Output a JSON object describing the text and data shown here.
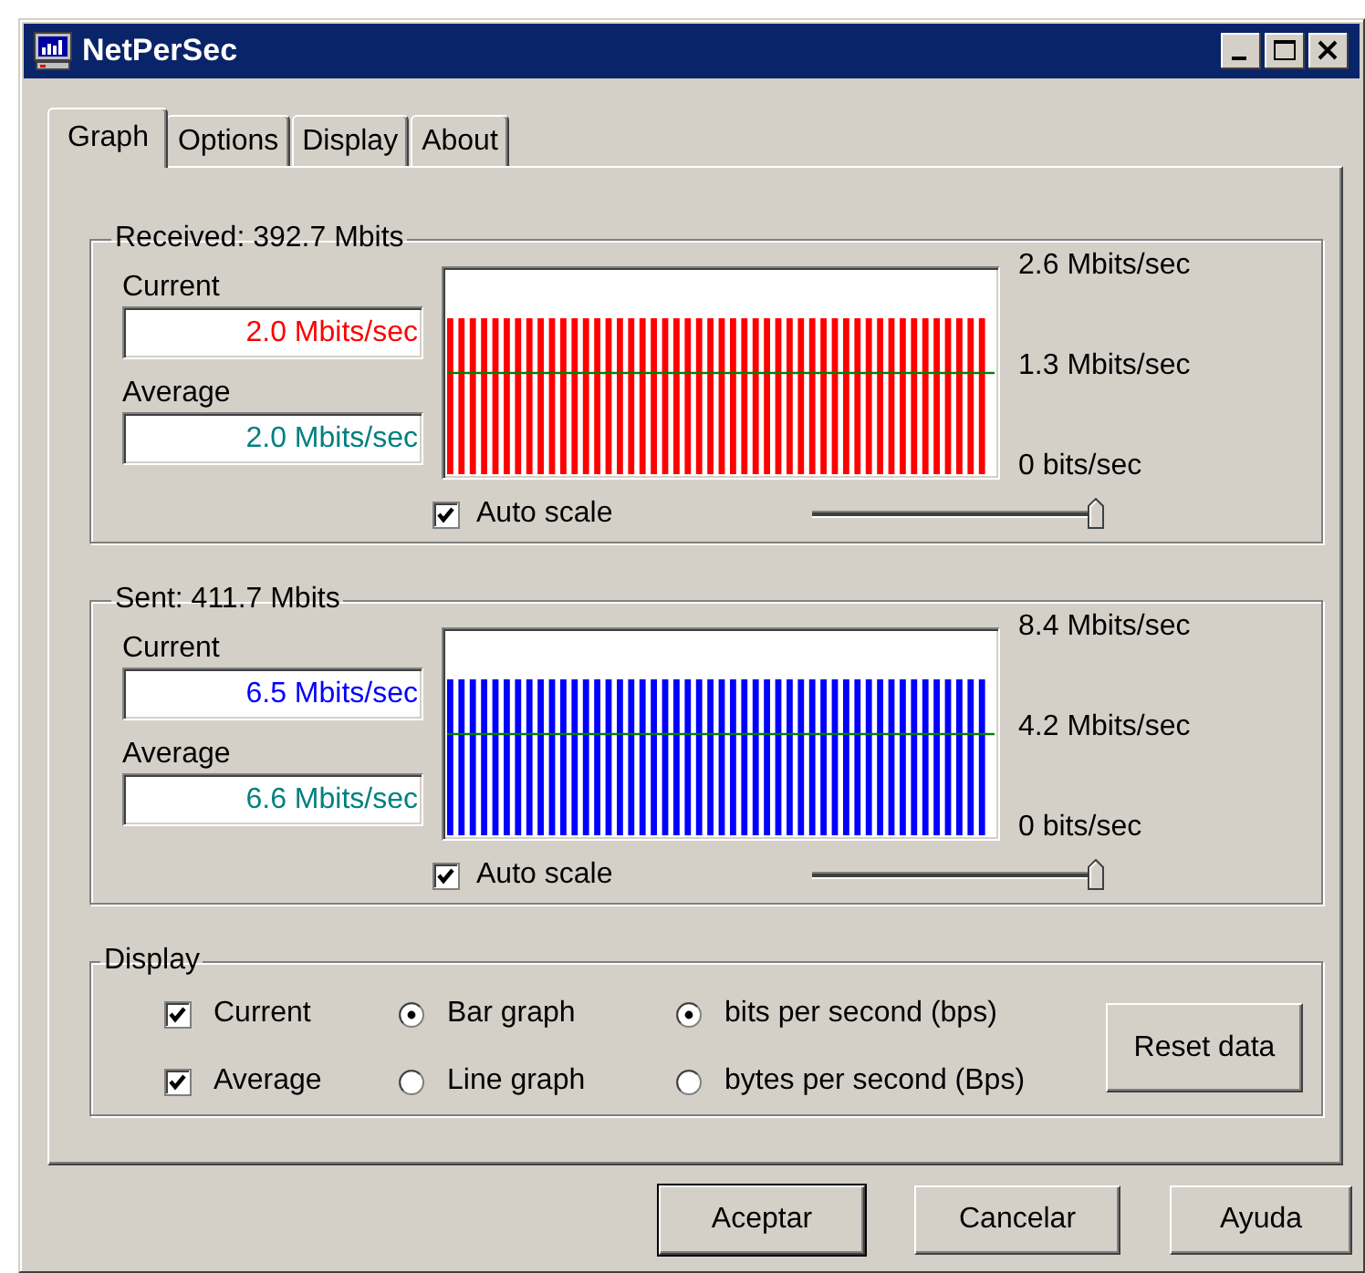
{
  "window": {
    "title": "NetPerSec"
  },
  "tabs": [
    {
      "label": "Graph",
      "selected": true
    },
    {
      "label": "Options",
      "selected": false
    },
    {
      "label": "Display",
      "selected": false
    },
    {
      "label": "About",
      "selected": false
    }
  ],
  "monitors": [
    {
      "title": "Received: 392.7 Mbits",
      "color": "#ff0000",
      "current_label": "Current",
      "current_value": "2.0 Mbits/sec",
      "average_label": "Average",
      "average_value": "2.0 Mbits/sec",
      "axis_labels": [
        "2.6 Mbits/sec",
        "1.3 Mbits/sec",
        "0  bits/sec"
      ],
      "auto_scale": {
        "label": "Auto scale",
        "checked": true
      },
      "scale_slider": {
        "level": 1
      }
    },
    {
      "title": "Sent: 411.7 Mbits",
      "color": "#0000ff",
      "current_label": "Current",
      "current_value": "6.5 Mbits/sec",
      "average_label": "Average",
      "average_value": "6.6 Mbits/sec",
      "axis_labels": [
        "8.4 Mbits/sec",
        "4.2 Mbits/sec",
        "0  bits/sec"
      ],
      "auto_scale": {
        "label": "Auto scale",
        "checked": true
      },
      "scale_slider": {
        "level": 1
      }
    }
  ],
  "display": {
    "title": "Display",
    "checkboxes": [
      {
        "label": "Current",
        "checked": true
      },
      {
        "label": "Average",
        "checked": true
      }
    ],
    "graph_types": [
      {
        "label": "Bar graph",
        "selected": true
      },
      {
        "label": "Line graph",
        "selected": false
      }
    ],
    "units": [
      {
        "label": "bits per second (bps)",
        "selected": true
      },
      {
        "label": "bytes per second (Bps)",
        "selected": false
      }
    ],
    "reset_button": "Reset data"
  },
  "buttons": [
    {
      "label": "Aceptar",
      "default": true
    },
    {
      "label": "Cancelar",
      "default": false
    },
    {
      "label": "Ayuda",
      "default": false
    }
  ]
}
